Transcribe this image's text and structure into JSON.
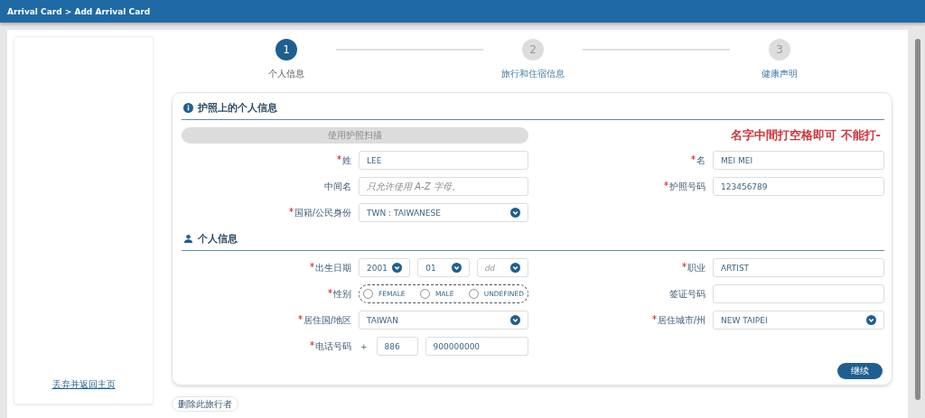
{
  "breadcrumb": "Arrival Card > Add Arrival Card",
  "sidebar": {
    "link": "丢弃并返回主页"
  },
  "steps": [
    {
      "number": "1",
      "label": "个人信息",
      "selected": true
    },
    {
      "number": "2",
      "label": "旅行和住宿信息",
      "selected": false
    },
    {
      "number": "3",
      "label": "健康声明",
      "selected": false
    }
  ],
  "sections": [
    {
      "title": "护照上的个人信息",
      "kind": "info",
      "scan_button": {
        "label": "使用护照扫描",
        "disabled": true
      },
      "note": "名字中間打空格即可 不能打-",
      "rows": [
        {
          "left": {
            "label": "姓",
            "required": true,
            "kind": "text",
            "value": "LEE"
          },
          "right": {
            "label": "名",
            "required": true,
            "kind": "text",
            "value": "MEI MEI"
          }
        },
        {
          "left": {
            "label": "中间名",
            "required": false,
            "kind": "text",
            "placeholder": "只允许使用 A-Z 字母。"
          },
          "right": {
            "label": "护照号码",
            "required": true,
            "kind": "text",
            "value": "123456789"
          }
        },
        {
          "left": {
            "label": "国籍/公民身份",
            "required": true,
            "kind": "select",
            "value": "TWN : TAIWANESE"
          }
        }
      ]
    },
    {
      "title": "个人信息",
      "kind": "person",
      "rows": [
        {
          "left": {
            "label": "出生日期",
            "required": true,
            "kind": "date",
            "parts": [
              {
                "value": "2001"
              },
              {
                "value": "01"
              },
              {
                "placeholder": "dd"
              }
            ]
          },
          "right": {
            "label": "职业",
            "required": true,
            "kind": "text",
            "value": "ARTIST"
          }
        },
        {
          "left": {
            "label": "性别",
            "required": true,
            "kind": "radio",
            "options": [
              {
                "label": "FEMALE",
                "selected": false
              },
              {
                "label": "MALE",
                "selected": false
              },
              {
                "label": "UNDEFINED",
                "selected": false
              }
            ]
          },
          "right": {
            "label": "签证号码",
            "required": false,
            "kind": "text"
          }
        },
        {
          "left": {
            "label": "居住国/地区",
            "required": true,
            "kind": "select",
            "value": "TAIWAN"
          },
          "right": {
            "label": "居住城市/州",
            "required": true,
            "kind": "select",
            "value": "NEW TAIPEI"
          }
        },
        {
          "left": {
            "label": "电话号码",
            "required": true,
            "kind": "phone",
            "prefix": "+",
            "code": "886",
            "number": "900000000"
          }
        }
      ]
    }
  ],
  "continue_button": "继续",
  "delete_button": "删除此旅行者"
}
